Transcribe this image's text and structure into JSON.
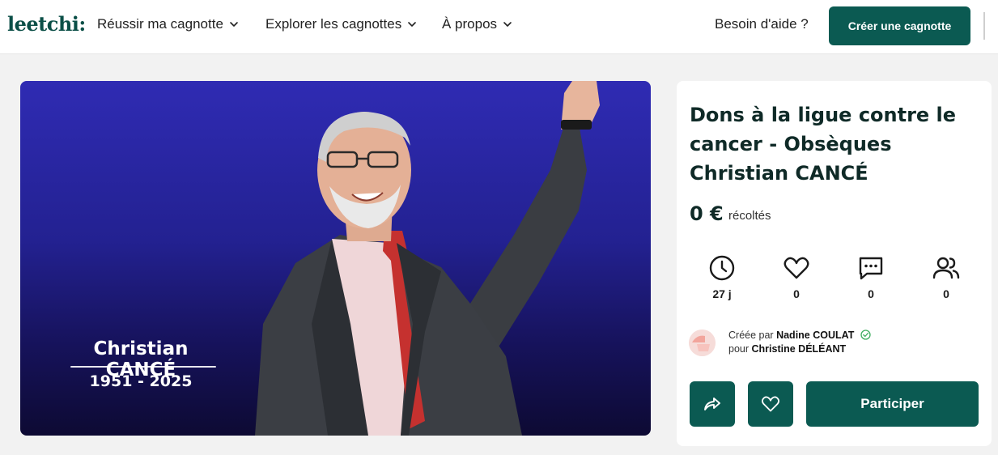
{
  "header": {
    "logo": "leetchi:",
    "nav": [
      {
        "label": "Réussir ma cagnotte",
        "icon": "chevron-down-icon"
      },
      {
        "label": "Explorer les cagnottes",
        "icon": "chevron-down-icon"
      },
      {
        "label": "À propos",
        "icon": "chevron-down-icon"
      }
    ],
    "help_label": "Besoin d'aide ?",
    "create_label": "Créer une cagnotte"
  },
  "hero": {
    "memorial_name": "Christian CANCÉ",
    "memorial_years": "1951 - 2025"
  },
  "card": {
    "title": "Dons à la ligue contre le cancer - Obsèques Christian CANCÉ",
    "amount": "0 €",
    "amount_label": "récoltés",
    "stats": [
      {
        "icon": "clock-icon",
        "value": "27 j"
      },
      {
        "icon": "heart-icon",
        "value": "0"
      },
      {
        "icon": "comment-icon",
        "value": "0"
      },
      {
        "icon": "participants-icon",
        "value": "0"
      }
    ],
    "creator_prefix": "Créée par",
    "creator_name": "Nadine COULAT",
    "beneficiary_prefix": "pour",
    "beneficiary_name": "Christine DÉLÉANT",
    "participate_label": "Participer"
  },
  "colors": {
    "brand": "#0b5a52",
    "hero_background": "#232191"
  }
}
